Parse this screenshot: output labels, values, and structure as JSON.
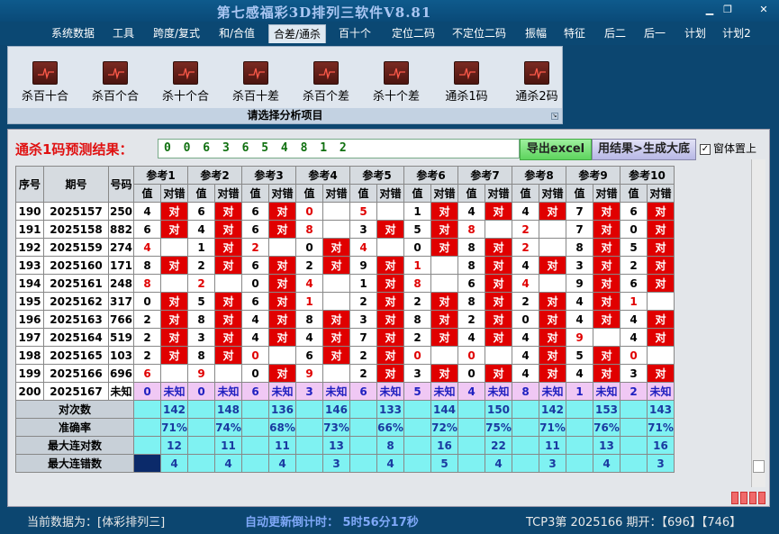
{
  "window": {
    "title": "第七感福彩3D排列三软件V8.81",
    "min": "▁",
    "max": "❐",
    "close": "✕"
  },
  "menu": [
    "系统数据",
    "工具",
    "跨度/复式",
    "和/合值",
    "合差/通杀",
    "百十个",
    "定位二码",
    "不定位二码",
    "振幅",
    "特征",
    "后二",
    "后一",
    "计划",
    "计划2"
  ],
  "ribbon": {
    "buttons": [
      "杀百十合",
      "杀百个合",
      "杀十个合",
      "杀百十差",
      "杀百个差",
      "杀十个差",
      "通杀1码",
      "通杀2码"
    ],
    "footer": "请选择分析项目"
  },
  "prediction": {
    "label": "通杀1码预测结果：",
    "value": "0 0 6 3 6 5 4 8 1 2",
    "excel_btn": "导出excel",
    "daily_btn": "用结果>生成大底",
    "topmost": "窗体置上",
    "topmost_checked": "✓"
  },
  "table": {
    "headers": {
      "seq": "序号",
      "period": "期号",
      "num": "号码",
      "ref": "参考",
      "val": "值",
      "ok": "对错",
      "ok_mark": "对",
      "unknown": "未知"
    },
    "refs": [
      "1",
      "2",
      "3",
      "4",
      "5",
      "6",
      "7",
      "8",
      "9",
      "10"
    ],
    "rows": [
      {
        "seq": "190",
        "period": "2025157",
        "num": "250",
        "v": [
          "4",
          "6",
          "6",
          "0",
          "5",
          "1",
          "4",
          "4",
          "7",
          "6"
        ],
        "r": [
          0,
          0,
          0,
          1,
          1,
          0,
          0,
          0,
          0,
          0
        ],
        "e": [
          1,
          1,
          1,
          0,
          0,
          1,
          1,
          1,
          1,
          1
        ]
      },
      {
        "seq": "191",
        "period": "2025158",
        "num": "882",
        "v": [
          "6",
          "4",
          "6",
          "8",
          "3",
          "5",
          "8",
          "2",
          "7",
          "0"
        ],
        "r": [
          0,
          0,
          0,
          1,
          0,
          0,
          1,
          1,
          0,
          0
        ],
        "e": [
          1,
          1,
          1,
          0,
          1,
          1,
          0,
          0,
          1,
          1
        ]
      },
      {
        "seq": "192",
        "period": "2025159",
        "num": "274",
        "v": [
          "4",
          "1",
          "2",
          "0",
          "4",
          "0",
          "8",
          "2",
          "8",
          "5"
        ],
        "r": [
          1,
          0,
          1,
          0,
          1,
          0,
          0,
          1,
          0,
          0
        ],
        "e": [
          0,
          1,
          0,
          1,
          0,
          1,
          1,
          0,
          1,
          1
        ]
      },
      {
        "seq": "193",
        "period": "2025160",
        "num": "171",
        "v": [
          "8",
          "2",
          "6",
          "2",
          "9",
          "1",
          "8",
          "4",
          "3",
          "2"
        ],
        "r": [
          0,
          0,
          0,
          0,
          0,
          1,
          0,
          0,
          0,
          0
        ],
        "e": [
          1,
          1,
          1,
          1,
          1,
          0,
          1,
          1,
          1,
          1
        ]
      },
      {
        "seq": "194",
        "period": "2025161",
        "num": "248",
        "v": [
          "8",
          "2",
          "0",
          "4",
          "1",
          "8",
          "6",
          "4",
          "9",
          "6"
        ],
        "r": [
          1,
          1,
          0,
          1,
          0,
          1,
          0,
          1,
          0,
          0
        ],
        "e": [
          0,
          0,
          1,
          0,
          1,
          0,
          1,
          0,
          1,
          1
        ]
      },
      {
        "seq": "195",
        "period": "2025162",
        "num": "317",
        "v": [
          "0",
          "5",
          "6",
          "1",
          "2",
          "2",
          "8",
          "2",
          "4",
          "1"
        ],
        "r": [
          0,
          0,
          0,
          1,
          0,
          0,
          0,
          0,
          0,
          1
        ],
        "e": [
          1,
          1,
          1,
          0,
          1,
          1,
          1,
          1,
          1,
          0
        ]
      },
      {
        "seq": "196",
        "period": "2025163",
        "num": "766",
        "v": [
          "2",
          "8",
          "4",
          "8",
          "3",
          "8",
          "2",
          "0",
          "4",
          "4"
        ],
        "r": [
          0,
          0,
          0,
          0,
          0,
          0,
          0,
          0,
          0,
          0
        ],
        "e": [
          1,
          1,
          1,
          1,
          1,
          1,
          1,
          1,
          1,
          1
        ]
      },
      {
        "seq": "197",
        "period": "2025164",
        "num": "519",
        "v": [
          "2",
          "3",
          "4",
          "4",
          "7",
          "2",
          "4",
          "4",
          "9",
          "4"
        ],
        "r": [
          0,
          0,
          0,
          0,
          0,
          0,
          0,
          0,
          1,
          0
        ],
        "e": [
          1,
          1,
          1,
          1,
          1,
          1,
          1,
          1,
          0,
          1
        ]
      },
      {
        "seq": "198",
        "period": "2025165",
        "num": "103",
        "v": [
          "2",
          "8",
          "0",
          "6",
          "2",
          "0",
          "0",
          "4",
          "5",
          "0"
        ],
        "r": [
          0,
          0,
          1,
          0,
          0,
          1,
          1,
          0,
          0,
          1
        ],
        "e": [
          1,
          1,
          0,
          1,
          1,
          0,
          0,
          1,
          1,
          0
        ]
      },
      {
        "seq": "199",
        "period": "2025166",
        "num": "696",
        "v": [
          "6",
          "9",
          "0",
          "9",
          "2",
          "3",
          "0",
          "4",
          "4",
          "3"
        ],
        "r": [
          1,
          1,
          0,
          1,
          0,
          0,
          0,
          0,
          0,
          0
        ],
        "e": [
          0,
          0,
          1,
          0,
          1,
          1,
          1,
          1,
          1,
          1
        ]
      }
    ],
    "pending": {
      "seq": "200",
      "period": "2025167",
      "num": "未知",
      "v": [
        "0",
        "0",
        "6",
        "3",
        "6",
        "5",
        "4",
        "8",
        "1",
        "2"
      ]
    },
    "stats": [
      {
        "label": "对次数",
        "values": [
          "142",
          "148",
          "136",
          "146",
          "133",
          "144",
          "150",
          "142",
          "153",
          "143"
        ]
      },
      {
        "label": "准确率",
        "values": [
          "71%",
          "74%",
          "68%",
          "73%",
          "66%",
          "72%",
          "75%",
          "71%",
          "76%",
          "71%"
        ]
      },
      {
        "label": "最大连对数",
        "values": [
          "12",
          "11",
          "11",
          "13",
          "8",
          "16",
          "22",
          "11",
          "13",
          "16"
        ]
      },
      {
        "label": "最大连错数",
        "values": [
          "4",
          "4",
          "4",
          "3",
          "4",
          "5",
          "4",
          "3",
          "4",
          "3"
        ]
      }
    ]
  },
  "status": {
    "left": "当前数据为：[体彩排列三]",
    "countdown": "自动更新倒计时：  5时56分17秒",
    "right": "TCP3第 2025166 期开：【696】【746】"
  },
  "colors": {
    "error": "#e00000",
    "stat_bg": "#7ff2f2",
    "pending_bg": "#f0c8f4",
    "bg": "#0c4670"
  }
}
